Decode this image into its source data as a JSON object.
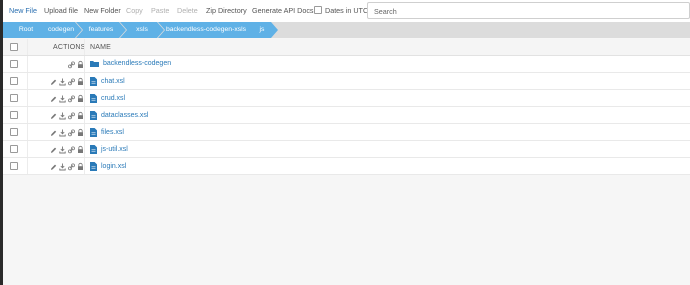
{
  "toolbar": {
    "new_file": "New File",
    "upload_file": "Upload file",
    "new_folder": "New Folder",
    "copy": "Copy",
    "paste": "Paste",
    "delete": "Delete",
    "zip_directory": "Zip Directory",
    "generate_api_docs": "Generate API Docs",
    "dates_in_utc": "Dates in UTC",
    "search_placeholder": "Search"
  },
  "breadcrumb": [
    "Root",
    "codegen",
    "features",
    "xsls",
    "backendless-codegen-xsls",
    "js"
  ],
  "table": {
    "headers": {
      "actions": "ACTIONS",
      "name": "NAME"
    },
    "rows": [
      {
        "name": "backendless-codegen",
        "type": "folder"
      },
      {
        "name": "chat.xsl",
        "type": "file"
      },
      {
        "name": "crud.xsl",
        "type": "file"
      },
      {
        "name": "dataclasses.xsl",
        "type": "file"
      },
      {
        "name": "files.xsl",
        "type": "file"
      },
      {
        "name": "js-util.xsl",
        "type": "file"
      },
      {
        "name": "login.xsl",
        "type": "file"
      }
    ]
  },
  "colors": {
    "accent": "#2a6fb0",
    "breadcrumb": "#5fb1e6",
    "link": "#2a7ab8",
    "disabled": "#b0b0b0"
  },
  "icons": {
    "row_actions_file": [
      "edit-icon",
      "download-icon",
      "link-icon",
      "lock-icon"
    ],
    "row_actions_folder": [
      "link-icon",
      "lock-icon"
    ]
  }
}
